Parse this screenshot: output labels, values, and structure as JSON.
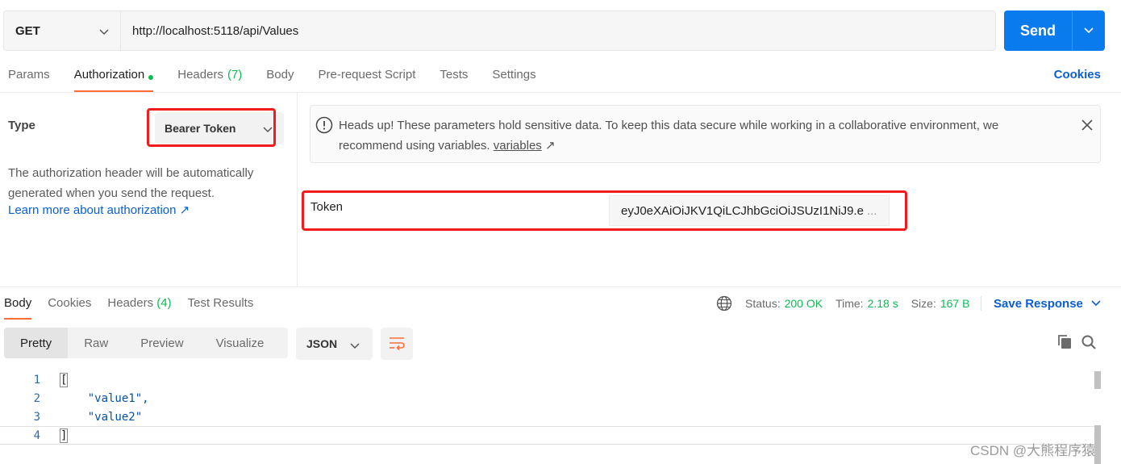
{
  "request": {
    "method": "GET",
    "url": "http://localhost:5118/api/Values",
    "send_label": "Send"
  },
  "request_tabs": [
    {
      "label": "Params"
    },
    {
      "label": "Authorization",
      "active": true
    },
    {
      "label": "Headers",
      "count": "(7)"
    },
    {
      "label": "Body"
    },
    {
      "label": "Pre-request Script"
    },
    {
      "label": "Tests"
    },
    {
      "label": "Settings"
    }
  ],
  "cookies_label": "Cookies",
  "auth": {
    "type_label": "Type",
    "type_value": "Bearer Token",
    "description": "The authorization header will be automatically generated when you send the request.",
    "learn_more": "Learn more about authorization ↗",
    "alert_text": "Heads up! These parameters hold sensitive data. To keep this data secure while working in a collaborative environment, we recommend using variables.",
    "alert_link": "variables",
    "token_label": "Token",
    "token_value": "eyJ0eXAiOiJKV1QiLCJhbGciOiJSUzI1NiJ9.e",
    "token_ellipsis": "..."
  },
  "response_tabs": [
    {
      "label": "Body",
      "active": true
    },
    {
      "label": "Cookies"
    },
    {
      "label": "Headers",
      "count": "(4)"
    },
    {
      "label": "Test Results"
    }
  ],
  "status": {
    "status_label": "Status:",
    "status_value": "200 OK",
    "time_label": "Time:",
    "time_value": "2.18 s",
    "size_label": "Size:",
    "size_value": "167 B",
    "save_response": "Save Response"
  },
  "format": {
    "options": [
      "Pretty",
      "Raw",
      "Preview",
      "Visualize"
    ],
    "active": "Pretty",
    "language": "JSON"
  },
  "code_lines": [
    {
      "n": "1",
      "text": "["
    },
    {
      "n": "2",
      "text": "    \"value1\","
    },
    {
      "n": "3",
      "text": "    \"value2\""
    },
    {
      "n": "4",
      "text": "]"
    }
  ],
  "watermark": "CSDN @大熊程序猿",
  "colors": {
    "accent_blue": "#097bed",
    "tab_underline": "#ff6c37",
    "success_green": "#0cbb52",
    "highlight_red": "#f21c1c"
  }
}
